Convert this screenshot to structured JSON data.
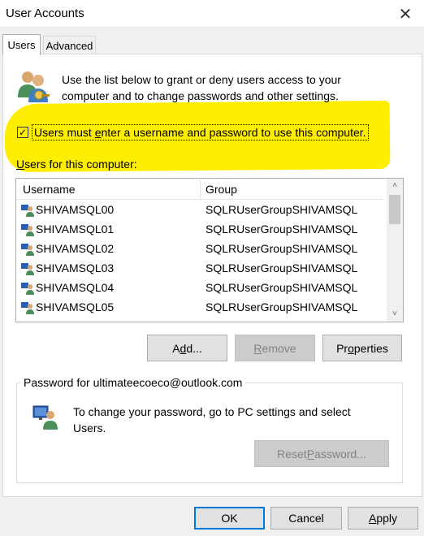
{
  "window": {
    "title": "User Accounts",
    "close_glyph": "✕"
  },
  "tabs": [
    {
      "label": "Users",
      "active": true
    },
    {
      "label": "Advanced",
      "active": false
    }
  ],
  "intro": {
    "icon": "users-group-icon",
    "text": "Use the list below to grant or deny users access to your computer and to change passwords and other settings."
  },
  "require_login": {
    "checked": true,
    "check_glyph": "✓",
    "label_before": "Users must ",
    "label_accel": "e",
    "label_after": "nter a username and password to use this computer."
  },
  "users_list": {
    "label_accel": "U",
    "label_rest": "sers for this computer:",
    "columns": [
      "Username",
      "Group"
    ],
    "rows": [
      {
        "username": "SHIVAMSQL00",
        "group": "SQLRUserGroupSHIVAMSQL"
      },
      {
        "username": "SHIVAMSQL01",
        "group": "SQLRUserGroupSHIVAMSQL"
      },
      {
        "username": "SHIVAMSQL02",
        "group": "SQLRUserGroupSHIVAMSQL"
      },
      {
        "username": "SHIVAMSQL03",
        "group": "SQLRUserGroupSHIVAMSQL"
      },
      {
        "username": "SHIVAMSQL04",
        "group": "SQLRUserGroupSHIVAMSQL"
      },
      {
        "username": "SHIVAMSQL05",
        "group": "SQLRUserGroupSHIVAMSQL"
      }
    ],
    "scroll_up": "˄",
    "scroll_down": "˅"
  },
  "list_buttons": {
    "add": {
      "before": "A",
      "accel": "d",
      "after": "d..."
    },
    "remove": {
      "before": "",
      "accel": "R",
      "after": "emove",
      "disabled": true
    },
    "properties": {
      "before": "Pr",
      "accel": "o",
      "after": "perties"
    }
  },
  "password": {
    "group_label": "Password for ultimateecoeco@outlook.com",
    "icon": "user-monitor-icon",
    "text": "To change your password, go to PC settings and select Users.",
    "reset": {
      "before": "Reset ",
      "accel": "P",
      "after": "assword...",
      "disabled": true
    }
  },
  "footer": {
    "ok": "OK",
    "cancel": "Cancel",
    "apply": {
      "accel": "A",
      "after": "pply"
    }
  },
  "colors": {
    "highlight": "#ffee00",
    "default_button_border": "#0078d7",
    "window_bg": "#f0f0f0"
  }
}
